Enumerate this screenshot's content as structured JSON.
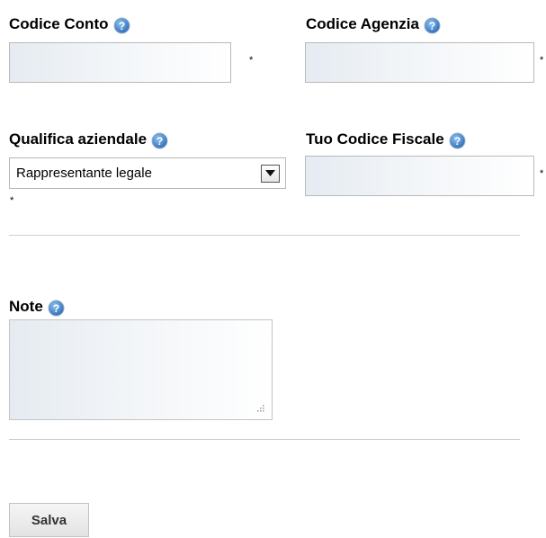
{
  "form": {
    "account_code": {
      "label": "Codice Conto",
      "value": "",
      "required_mark": "*"
    },
    "agency_code": {
      "label": "Codice Agenzia",
      "value": "",
      "required_mark": "*"
    },
    "company_role": {
      "label": "Qualifica aziendale",
      "selected": "Rappresentante legale",
      "required_mark": "*"
    },
    "tax_code": {
      "label": "Tuo Codice Fiscale",
      "value": "",
      "required_mark": "*"
    },
    "notes": {
      "label": "Note",
      "value": ""
    },
    "save_label": "Salva"
  },
  "icons": {
    "help": "help-question-icon",
    "dropdown": "chevron-down-icon",
    "resize": "resize-grip-icon"
  },
  "colors": {
    "help_icon": "#3d82c9",
    "divider": "#cfcfcf",
    "field_border": "#b9b9b9"
  }
}
